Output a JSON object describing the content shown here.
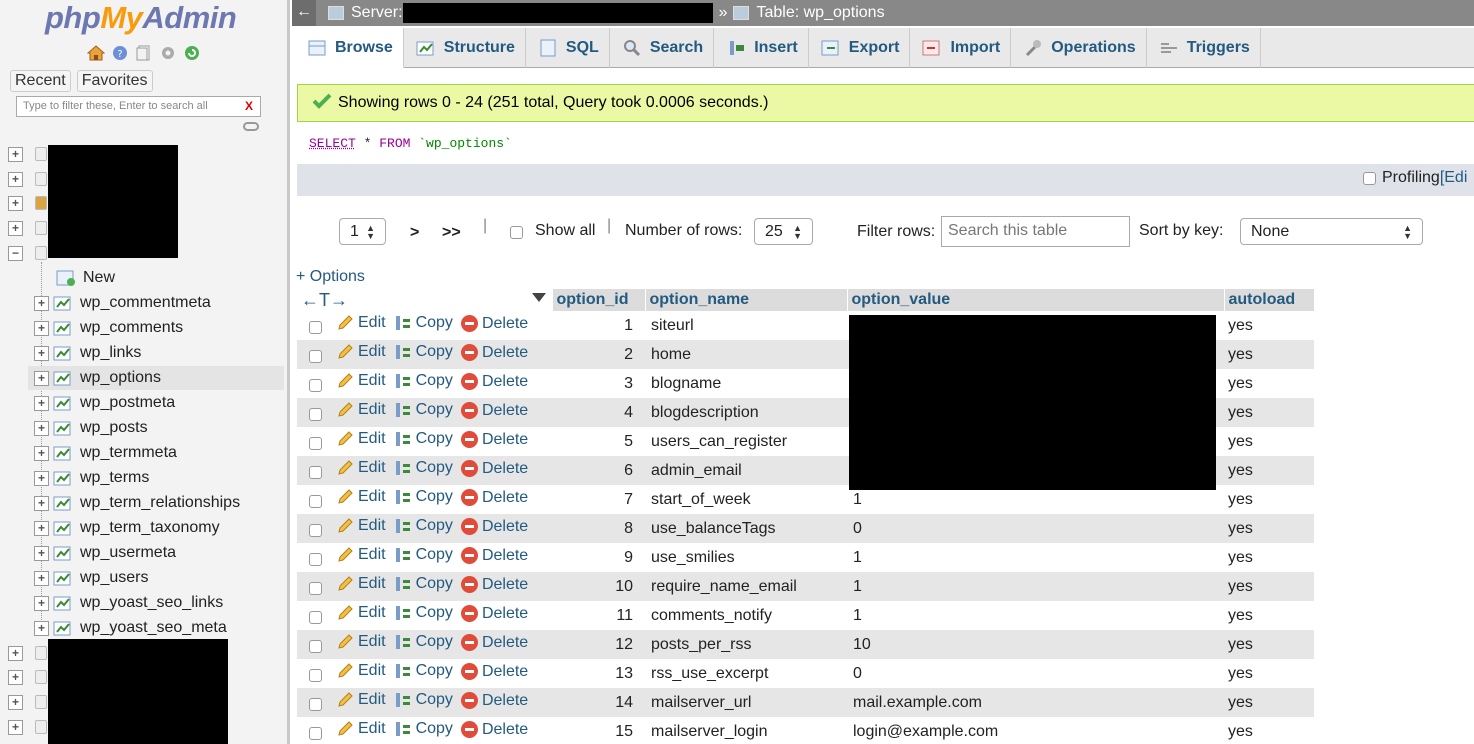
{
  "sidebar": {
    "logo": {
      "php": "php",
      "my": "My",
      "admin": "Admin"
    },
    "recent_label": "Recent",
    "favorites_label": "Favorites",
    "filter_placeholder": "Type to filter these, Enter to search all",
    "filter_clear": "X",
    "new_label": "New",
    "tables": [
      "wp_commentmeta",
      "wp_comments",
      "wp_links",
      "wp_options",
      "wp_postmeta",
      "wp_posts",
      "wp_termmeta",
      "wp_terms",
      "wp_term_relationships",
      "wp_term_taxonomy",
      "wp_usermeta",
      "wp_users",
      "wp_yoast_seo_links",
      "wp_yoast_seo_meta"
    ],
    "selected_table": "wp_options"
  },
  "topbar": {
    "back": "←",
    "server_label": "Server:",
    "separator": "»",
    "table_label": "Table: wp_options"
  },
  "tabs": [
    {
      "label": "Browse",
      "icon": "browse-icon"
    },
    {
      "label": "Structure",
      "icon": "structure-icon"
    },
    {
      "label": "SQL",
      "icon": "sql-icon"
    },
    {
      "label": "Search",
      "icon": "search-icon"
    },
    {
      "label": "Insert",
      "icon": "insert-icon"
    },
    {
      "label": "Export",
      "icon": "export-icon"
    },
    {
      "label": "Import",
      "icon": "import-icon"
    },
    {
      "label": "Operations",
      "icon": "wrench-icon"
    },
    {
      "label": "Triggers",
      "icon": "triggers-icon"
    }
  ],
  "message": {
    "text": "Showing rows 0 - 24 (251 total, Query took 0.0006 seconds.)"
  },
  "sql": {
    "select": "SELECT",
    "star": " * ",
    "from": "FROM",
    "table": " `wp_options`"
  },
  "profiling": {
    "label": "Profiling",
    "edit": "[Edi"
  },
  "navigation": {
    "page": "1",
    "next": ">",
    "last": ">>",
    "divider": "|",
    "show_all": "Show all",
    "rows_label": "Number of rows:",
    "rows_value": "25",
    "filter_label": "Filter rows:",
    "filter_placeholder": "Search this table",
    "sort_label": "Sort by key:",
    "sort_value": "None"
  },
  "options_link": "+ Options",
  "table": {
    "resize_arrows": "←T→",
    "columns": [
      "option_id",
      "option_name",
      "option_value",
      "autoload"
    ],
    "actions": {
      "edit": "Edit",
      "copy": "Copy",
      "delete": "Delete"
    },
    "rows": [
      {
        "id": "1",
        "name": "siteurl",
        "value": "",
        "autoload": "yes"
      },
      {
        "id": "2",
        "name": "home",
        "value": "",
        "autoload": "yes"
      },
      {
        "id": "3",
        "name": "blogname",
        "value": "",
        "autoload": "yes"
      },
      {
        "id": "4",
        "name": "blogdescription",
        "value": "",
        "autoload": "yes"
      },
      {
        "id": "5",
        "name": "users_can_register",
        "value": "",
        "autoload": "yes"
      },
      {
        "id": "6",
        "name": "admin_email",
        "value": "",
        "autoload": "yes"
      },
      {
        "id": "7",
        "name": "start_of_week",
        "value": "1",
        "autoload": "yes"
      },
      {
        "id": "8",
        "name": "use_balanceTags",
        "value": "0",
        "autoload": "yes"
      },
      {
        "id": "9",
        "name": "use_smilies",
        "value": "1",
        "autoload": "yes"
      },
      {
        "id": "10",
        "name": "require_name_email",
        "value": "1",
        "autoload": "yes"
      },
      {
        "id": "11",
        "name": "comments_notify",
        "value": "1",
        "autoload": "yes"
      },
      {
        "id": "12",
        "name": "posts_per_rss",
        "value": "10",
        "autoload": "yes"
      },
      {
        "id": "13",
        "name": "rss_use_excerpt",
        "value": "0",
        "autoload": "yes"
      },
      {
        "id": "14",
        "name": "mailserver_url",
        "value": "mail.example.com",
        "autoload": "yes"
      },
      {
        "id": "15",
        "name": "mailserver_login",
        "value": "login@example.com",
        "autoload": "yes"
      }
    ]
  },
  "colors": {
    "link": "#235a81",
    "success_bg": "#ebf8a4",
    "delete_red": "#e04b3a"
  }
}
